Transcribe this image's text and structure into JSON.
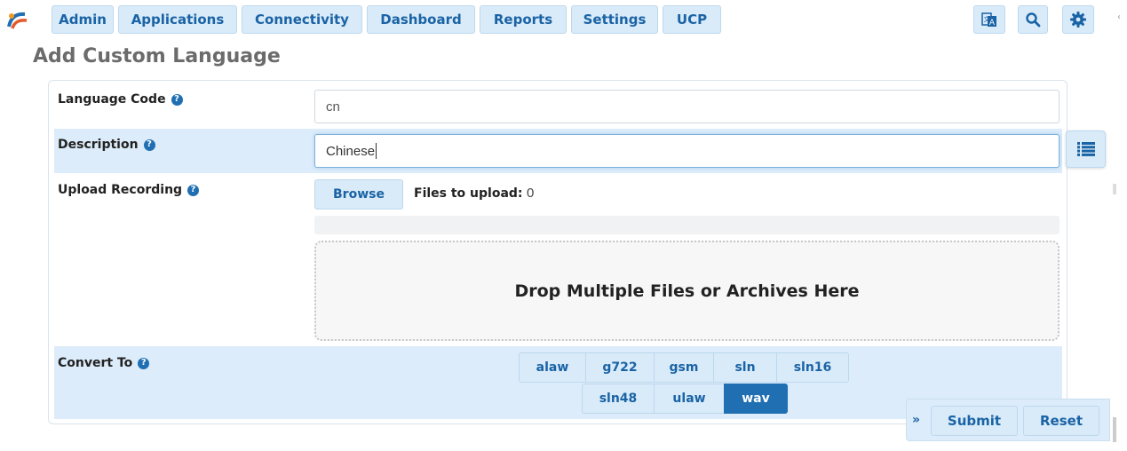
{
  "nav": {
    "items": [
      "Admin",
      "Applications",
      "Connectivity",
      "Dashboard",
      "Reports",
      "Settings",
      "UCP"
    ],
    "icons": [
      "language-icon",
      "search-icon",
      "gear-icon"
    ]
  },
  "page": {
    "title": "Add Custom Language"
  },
  "form": {
    "language_code": {
      "label": "Language Code",
      "value": "cn"
    },
    "description": {
      "label": "Description",
      "value": "Chinese"
    },
    "upload": {
      "label": "Upload Recording",
      "browse_label": "Browse",
      "files_label": "Files to upload:",
      "files_count": "0",
      "dropzone_text": "Drop Multiple Files or Archives Here"
    },
    "convert_to": {
      "label": "Convert To",
      "formats": [
        "alaw",
        "g722",
        "gsm",
        "sln",
        "sln16",
        "sln48",
        "ulaw",
        "wav"
      ],
      "selected": "wav"
    },
    "help_glyph": "?"
  },
  "actions": {
    "chevron": "»",
    "submit": "Submit",
    "reset": "Reset"
  },
  "edge_char": "‹",
  "colors": {
    "accent": "#1f6fb2",
    "button_bg": "#d9ebf9",
    "row_highlight": "#dcecfa"
  }
}
